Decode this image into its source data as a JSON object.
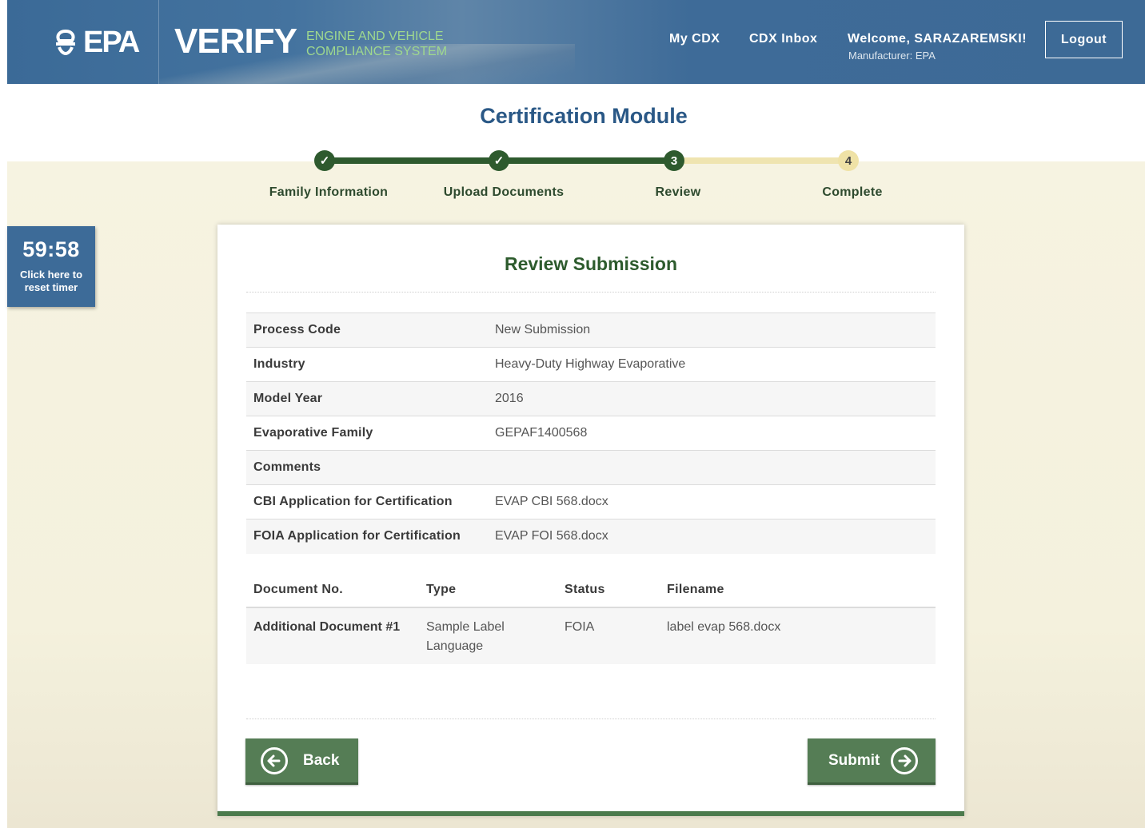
{
  "header": {
    "logo_text": "EPA",
    "app_name": "VERIFY",
    "system_line1": "ENGINE AND VEHICLE",
    "system_line2": "COMPLIANCE SYSTEM",
    "nav": [
      "My CDX",
      "CDX Inbox"
    ],
    "welcome": "Welcome, SARAZAREMSKI!",
    "manufacturer": "Manufacturer: EPA",
    "logout_label": "Logout"
  },
  "module_title": "Certification Module",
  "steps": [
    {
      "label": "Family Information",
      "state": "done",
      "marker": "✓"
    },
    {
      "label": "Upload Documents",
      "state": "done",
      "marker": "✓"
    },
    {
      "label": "Review",
      "state": "current",
      "marker": "3"
    },
    {
      "label": "Complete",
      "state": "todo",
      "marker": "4"
    }
  ],
  "timer": {
    "time": "59:58",
    "hint_line1": "Click here to",
    "hint_line2": "reset timer"
  },
  "review": {
    "title": "Review Submission",
    "rows": [
      {
        "key": "Process Code",
        "value": "New Submission"
      },
      {
        "key": "Industry",
        "value": "Heavy-Duty Highway Evaporative"
      },
      {
        "key": "Model Year",
        "value": "2016"
      },
      {
        "key": "Evaporative Family",
        "value": "GEPAF1400568"
      },
      {
        "key": "Comments",
        "value": ""
      },
      {
        "key": "CBI Application for Certification",
        "value": "EVAP CBI 568.docx"
      },
      {
        "key": "FOIA Application for Certification",
        "value": "EVAP FOI 568.docx"
      }
    ],
    "docs_headers": {
      "doc_no": "Document No.",
      "type": "Type",
      "status": "Status",
      "filename": "Filename"
    },
    "docs": [
      {
        "doc_no": "Additional Document #1",
        "type_line1": "Sample Label",
        "type_line2": "Language",
        "status": "FOIA",
        "filename": "label evap 568.docx"
      }
    ],
    "back_label": "Back",
    "submit_label": "Submit"
  },
  "colors": {
    "header_blue": "#3d6a96",
    "step_green": "#2e5a2e",
    "step_pending": "#efe2a6",
    "button_green": "#557d55",
    "title_blue": "#2a5886"
  }
}
